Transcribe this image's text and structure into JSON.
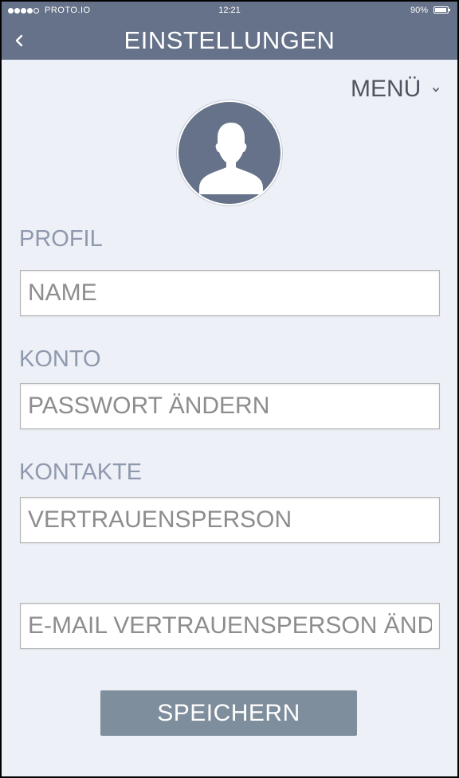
{
  "status_bar": {
    "carrier": "PROTO.IO",
    "time": "12:21",
    "battery": "90%",
    "signal_bars_filled": 4,
    "signal_bars_total": 5
  },
  "header": {
    "title": "EINSTELLUNGEN",
    "back_icon": "chevron-left-icon"
  },
  "menu": {
    "label": "MENÜ",
    "icon": "chevron-down-icon"
  },
  "avatar": {
    "icon": "user-silhouette-icon"
  },
  "sections": {
    "profile": {
      "label": "PROFIL",
      "name_placeholder": "NAME"
    },
    "account": {
      "label": "KONTO",
      "password_placeholder": "PASSWORT ÄNDERN"
    },
    "contacts": {
      "label": "KONTAKTE",
      "trusted_person_placeholder": "VERTRAUENSPERSON",
      "trusted_email_placeholder": "E-MAIL VERTRAUENSPERSON ÄNDERN"
    }
  },
  "actions": {
    "save_label": "SPEICHERN"
  },
  "colors": {
    "header": "#667289",
    "background": "#edf0f7",
    "section_label": "#8f99ae",
    "save_button": "#7f8e9c"
  }
}
